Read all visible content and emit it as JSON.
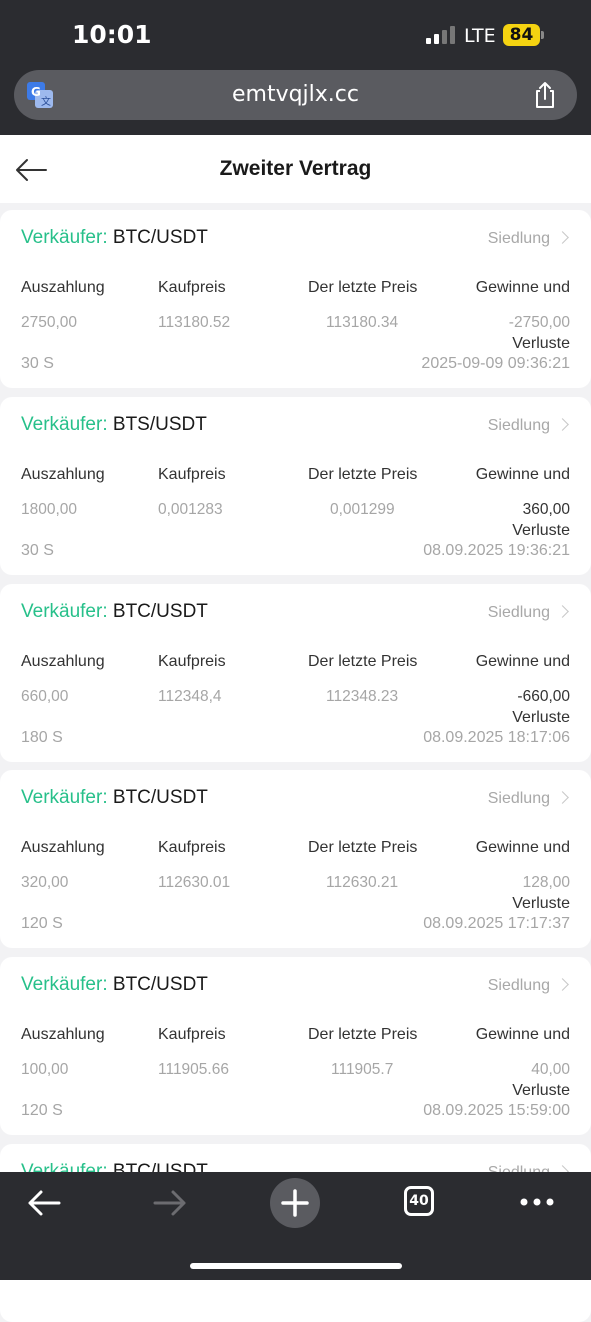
{
  "status": {
    "time": "10:01",
    "network": "LTE",
    "battery": "84"
  },
  "browser": {
    "url": "emtvqjlx.cc",
    "tab_count": "40"
  },
  "header": {
    "title": "Zweiter Vertrag"
  },
  "labels": {
    "side": "Verkäufer:",
    "settle": "Siedlung",
    "payout": "Auszahlung",
    "buy_price": "Kaufpreis",
    "last_price": "Der letzte Preis",
    "pnl_1": "Gewinne und",
    "pnl_2": "Verluste"
  },
  "contracts": [
    {
      "pair": "BTC/USDT",
      "payout": "2750,00",
      "buy_price": "113180.52",
      "last_price": "113180.34",
      "pnl": "-2750,00",
      "duration": "30 S",
      "time": "2025-09-09 09:36:21"
    },
    {
      "pair": "BTS/USDT",
      "payout": "1800,00",
      "buy_price": "0,001283",
      "last_price": "0,001299",
      "pnl": "360,00",
      "duration": "30 S",
      "time": "08.09.2025 19:36:21"
    },
    {
      "pair": "BTC/USDT",
      "payout": "660,00",
      "buy_price": "112348,4",
      "last_price": "112348.23",
      "pnl": "-660,00",
      "duration": "180 S",
      "time": "08.09.2025 18:17:06"
    },
    {
      "pair": "BTC/USDT",
      "payout": "320,00",
      "buy_price": "112630.01",
      "last_price": "112630.21",
      "pnl": "128,00",
      "duration": "120 S",
      "time": "08.09.2025 17:17:37"
    },
    {
      "pair": "BTC/USDT",
      "payout": "100,00",
      "buy_price": "111905.66",
      "last_price": "111905.7",
      "pnl": "40,00",
      "duration": "120 S",
      "time": "08.09.2025 15:59:00"
    },
    {
      "pair": "BTC/USDT",
      "payout": "",
      "buy_price": "",
      "last_price": "",
      "pnl": "",
      "duration": "",
      "time": ""
    }
  ],
  "colors": {
    "accent": "#27c08a",
    "chrome": "#2b2c30"
  }
}
